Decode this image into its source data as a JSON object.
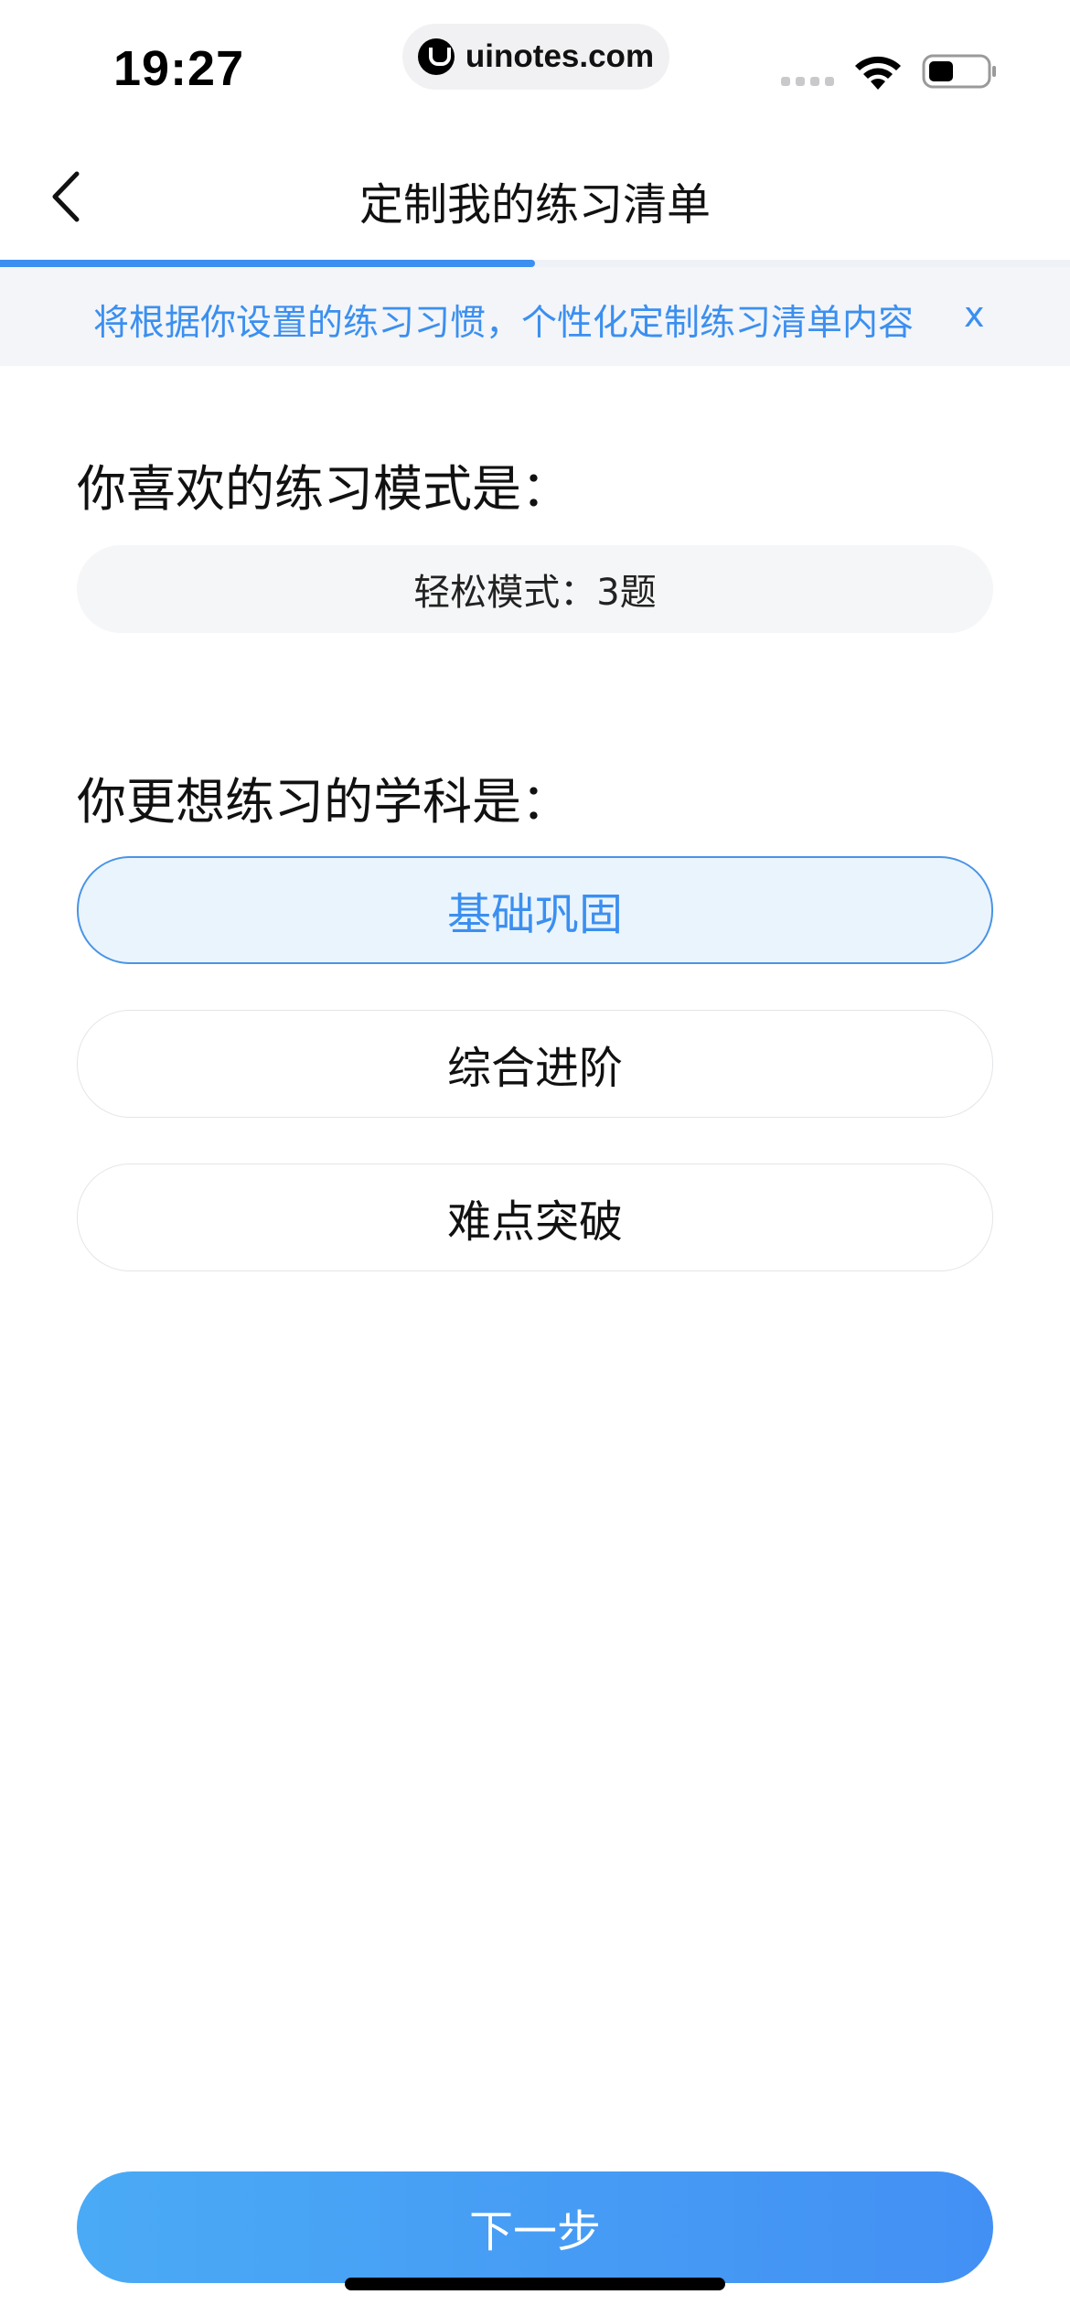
{
  "status_bar": {
    "time": "19:27",
    "url": "uinotes.com"
  },
  "nav": {
    "title": "定制我的练习清单"
  },
  "progress": {
    "value": 0.5,
    "color": "#3b8ff0"
  },
  "banner": {
    "text": "将根据你设置的练习习惯，个性化定制练习清单内容",
    "close_label": "x"
  },
  "mode_section": {
    "title": "你喜欢的练习模式是：",
    "selected_mode": "轻松模式：3题"
  },
  "subject_section": {
    "title": "你更想练习的学科是：",
    "options": [
      {
        "label": "基础巩固",
        "selected": true
      },
      {
        "label": "综合进阶",
        "selected": false
      },
      {
        "label": "难点突破",
        "selected": false
      }
    ]
  },
  "next_button": {
    "label": "下一步"
  },
  "colors": {
    "accent": "#3b8ff0",
    "selected_bg": "#eaf4fd",
    "button_gradient_start": "#4aaaf5",
    "button_gradient_end": "#4390f4"
  },
  "icons": {
    "back": "chevron-left-icon",
    "wifi": "wifi-icon",
    "battery": "battery-icon",
    "site_logo": "uinotes-logo-icon"
  }
}
